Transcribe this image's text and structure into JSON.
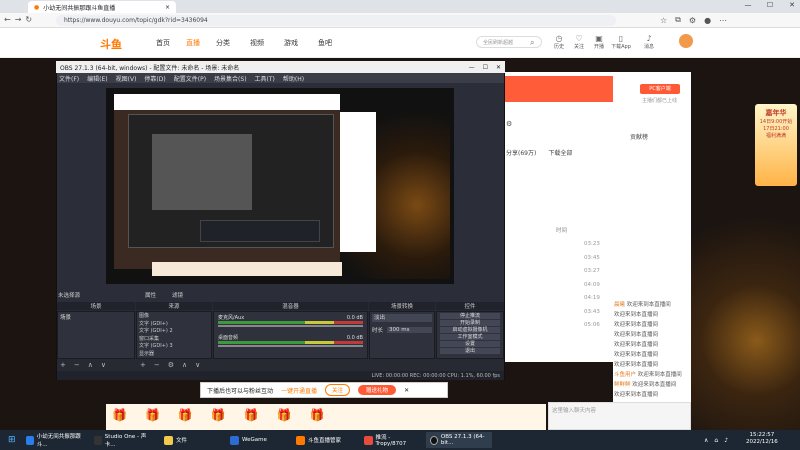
{
  "browser": {
    "tab_title": "小幼无间共振那跟斗鱼直播",
    "url": "https://www.douyu.com/topic/gdk?rid=3436094"
  },
  "site": {
    "logo": "斗鱼",
    "nav": [
      "首页",
      "直播",
      "分类",
      "视频",
      "游戏",
      "鱼吧"
    ],
    "search_placeholder": "全民刷新超越",
    "header_icons": [
      "历史",
      "关注",
      "开播",
      "下载App",
      "消息"
    ],
    "pc_client": "PC客户端",
    "pc_client_sub": "主播们都已上线",
    "share": "分享(69万)",
    "download": "下载全部",
    "time_col": "时间",
    "rank_label": "贡献榜",
    "chat_lines": [
      {
        "user": "晨曦",
        "text": "欢迎来到本直播间"
      },
      {
        "user": "",
        "text": "欢迎来到本直播间"
      },
      {
        "user": "",
        "text": "欢迎来到本直播间"
      },
      {
        "user": "",
        "text": "欢迎来到本直播间"
      },
      {
        "user": "",
        "text": "欢迎来到本直播间"
      },
      {
        "user": "",
        "text": "欢迎来到本直播间"
      },
      {
        "user": "",
        "text": "欢迎来到本直播间"
      },
      {
        "user": "斗鱼用户",
        "text": "欢迎来到本直播间"
      },
      {
        "user": "鲜鲜鲜",
        "text": "欢迎来到本直播间"
      },
      {
        "user": "",
        "text": "欢迎来到本直播间"
      }
    ],
    "time_values": [
      "03:23",
      "03:45",
      "03:27",
      "04:09",
      "04:19",
      "03:43",
      "05:06"
    ],
    "promo_text": [
      "嘉年华",
      "14日9:00开始",
      "17日21:00",
      "福利满满"
    ],
    "chat_placeholder": "这里输入聊天内容"
  },
  "obs": {
    "title": "OBS 27.1.3 (64-bit, windows) - 配置文件: 未命名 - 场景: 未命名",
    "menu": [
      "文件(F)",
      "编辑(E)",
      "视图(V)",
      "停靠(D)",
      "配置文件(P)",
      "场景集合(S)",
      "工具(T)",
      "帮助(H)"
    ],
    "docks": [
      "场景",
      "来源",
      "混音器",
      "场景转换",
      "控件"
    ],
    "scene": "场景",
    "sources": [
      "图像",
      "文字 (GDI+)",
      "文字 (GDI+) 2",
      "窗口采集",
      "文字 (GDI+) 3",
      "显示器"
    ],
    "mixer": [
      {
        "name": "麦克风/Aux",
        "db": "0.0 dB"
      },
      {
        "name": "桌面音频",
        "db": "0.0 dB"
      }
    ],
    "transition": "淡出",
    "duration_label": "时长",
    "duration": "300 ms",
    "controls": [
      "停止推流",
      "开始录制",
      "启动虚拟摄像机",
      "工作室模式",
      "设置",
      "退出"
    ],
    "no_source": "未选择源",
    "properties": "属性",
    "filters": "滤镜",
    "status": "LIVE: 00:00:00  REC: 00:00:00  CPU: 1.1%, 60.00 fps"
  },
  "popup": {
    "text": "下播后也可以与粉丝互动",
    "link": "一键开通直播",
    "follow": "关注",
    "gift": "赠送礼物"
  },
  "taskbar": {
    "items": [
      "小幼无间共振那跟斗...",
      "Studio One - 声卡...",
      "文件",
      "WeGame",
      "斗鱼直播管家",
      "推流 - Tropy/8707",
      "OBS 27.1.3 (64-bit..."
    ],
    "time": "15:22:57",
    "date": "2022/12/16"
  },
  "colors": {
    "accent": "#ff7a00",
    "obs_bg": "#2b2e38",
    "site_red": "#ff5d3a"
  }
}
